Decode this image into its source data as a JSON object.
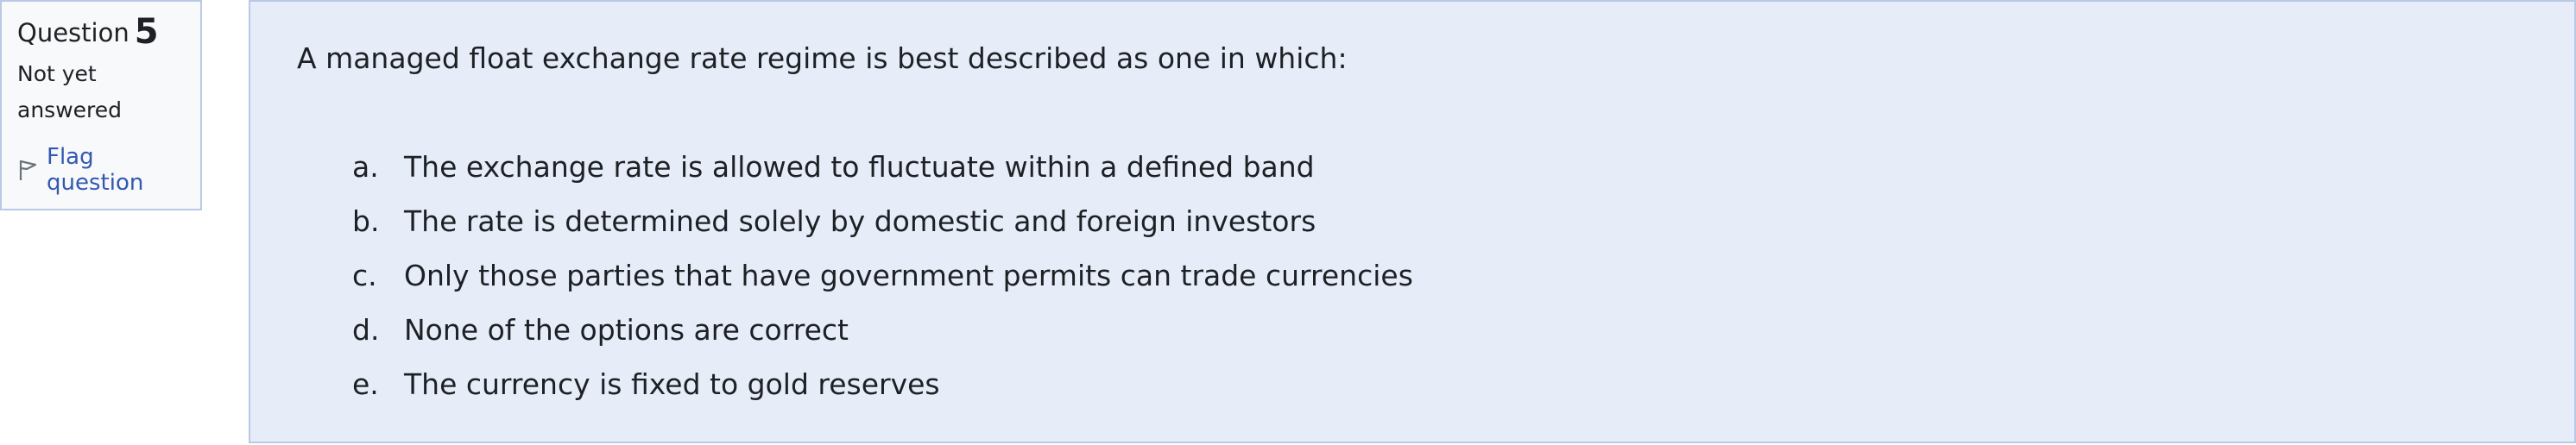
{
  "question_info": {
    "label": "Question",
    "number": "5",
    "state_line1": "Not yet",
    "state_line2": "answered",
    "flag_label": "Flag question",
    "flag_icon": "flag-outline-icon"
  },
  "question": {
    "text": "A managed float exchange rate regime is best described as one in which:",
    "answers": [
      {
        "letter": "a.",
        "text": "The exchange rate is allowed to fluctuate within a defined band"
      },
      {
        "letter": "b.",
        "text": "The rate is determined solely by domestic and foreign investors"
      },
      {
        "letter": "c.",
        "text": "Only those parties that have government permits can trade currencies"
      },
      {
        "letter": "d.",
        "text": "None of the options are correct"
      },
      {
        "letter": "e.",
        "text": "The currency is fixed to gold reserves"
      }
    ]
  },
  "colors": {
    "info_background": "#f8f9fa",
    "content_background": "#e7edf8",
    "border": "#b8c9e6",
    "link": "#3358b3",
    "text": "#1d2125"
  }
}
